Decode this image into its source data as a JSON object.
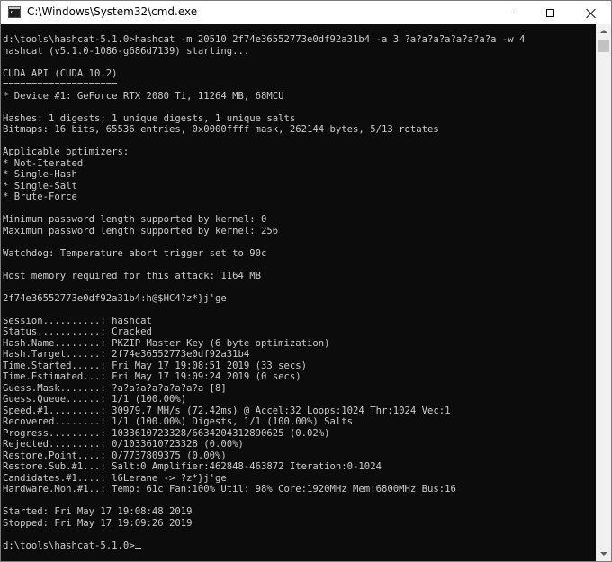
{
  "window": {
    "title": "C:\\Windows\\System32\\cmd.exe",
    "icon": "cmd-icon",
    "controls": {
      "minimize_icon": "minimize-icon",
      "maximize_icon": "maximize-icon",
      "close_icon": "close-icon"
    }
  },
  "console": {
    "lines": [
      "d:\\tools\\hashcat-5.1.0>hashcat -m 20510 2f74e36552773e0df92a31b4 -a 3 ?a?a?a?a?a?a?a?a -w 4",
      "hashcat (v5.1.0-1086-g686d7139) starting...",
      "",
      "CUDA API (CUDA 10.2)",
      "====================",
      "* Device #1: GeForce RTX 2080 Ti, 11264 MB, 68MCU",
      "",
      "Hashes: 1 digests; 1 unique digests, 1 unique salts",
      "Bitmaps: 16 bits, 65536 entries, 0x0000ffff mask, 262144 bytes, 5/13 rotates",
      "",
      "Applicable optimizers:",
      "* Not-Iterated",
      "* Single-Hash",
      "* Single-Salt",
      "* Brute-Force",
      "",
      "Minimum password length supported by kernel: 0",
      "Maximum password length supported by kernel: 256",
      "",
      "Watchdog: Temperature abort trigger set to 90c",
      "",
      "Host memory required for this attack: 1164 MB",
      "",
      "2f74e36552773e0df92a31b4:h@$HC4?z*}j'ge",
      "",
      "Session..........: hashcat",
      "Status...........: Cracked",
      "Hash.Name........: PKZIP Master Key (6 byte optimization)",
      "Hash.Target......: 2f74e36552773e0df92a31b4",
      "Time.Started.....: Fri May 17 19:08:51 2019 (33 secs)",
      "Time.Estimated...: Fri May 17 19:09:24 2019 (0 secs)",
      "Guess.Mask.......: ?a?a?a?a?a?a?a?a [8]",
      "Guess.Queue......: 1/1 (100.00%)",
      "Speed.#1.........: 30979.7 MH/s (72.42ms) @ Accel:32 Loops:1024 Thr:1024 Vec:1",
      "Recovered........: 1/1 (100.00%) Digests, 1/1 (100.00%) Salts",
      "Progress.........: 1033610723328/6634204312890625 (0.02%)",
      "Rejected.........: 0/1033610723328 (0.00%)",
      "Restore.Point....: 0/7737809375 (0.00%)",
      "Restore.Sub.#1...: Salt:0 Amplifier:462848-463872 Iteration:0-1024",
      "Candidates.#1....: l6Lerane -> ?z*}j'ge",
      "Hardware.Mon.#1..: Temp: 61c Fan:100% Util: 98% Core:1920MHz Mem:6800MHz Bus:16",
      "",
      "Started: Fri May 17 19:08:48 2019",
      "Stopped: Fri May 17 19:09:26 2019",
      ""
    ],
    "prompt": "d:\\tools\\hashcat-5.1.0>"
  },
  "scrollbar": {
    "up_icon": "scroll-up-arrow-icon",
    "down_icon": "scroll-down-arrow-icon"
  }
}
